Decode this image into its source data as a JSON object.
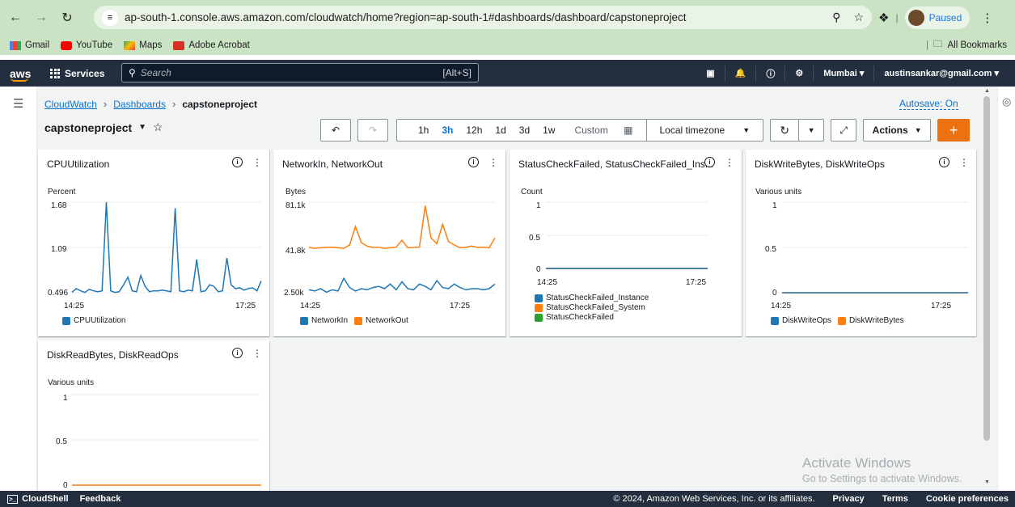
{
  "browser": {
    "url": "ap-south-1.console.aws.amazon.com/cloudwatch/home?region=ap-south-1#dashboards/dashboard/capstoneproject",
    "profile_status": "Paused"
  },
  "bookmarks": {
    "items": [
      "Gmail",
      "YouTube",
      "Maps",
      "Adobe Acrobat"
    ],
    "all_label": "All Bookmarks"
  },
  "aws_nav": {
    "logo": "aws",
    "services": "Services",
    "search_placeholder": "Search",
    "search_shortcut": "[Alt+S]",
    "region": "Mumbai ▾",
    "account": "austinsankar@gmail.com ▾"
  },
  "breadcrumb": {
    "items": [
      "CloudWatch",
      "Dashboards"
    ],
    "current": "capstoneproject"
  },
  "autosave": "Autosave: On",
  "dashboard": {
    "title": "capstoneproject",
    "time_ranges": [
      "1h",
      "3h",
      "12h",
      "1d",
      "3d",
      "1w",
      "Custom"
    ],
    "selected_range": "3h",
    "timezone": "Local timezone",
    "actions": "Actions"
  },
  "widgets": [
    {
      "title": "CPUUtilization",
      "unit": "Percent",
      "yticks": [
        "1.68",
        "1.09",
        "0.496"
      ],
      "xticks": [
        "14:25",
        "17:25"
      ],
      "legend": [
        "CPUUtilization"
      ]
    },
    {
      "title": "NetworkIn, NetworkOut",
      "unit": "Bytes",
      "yticks": [
        "81.1k",
        "41.8k",
        "2.50k"
      ],
      "xticks": [
        "14:25",
        "17:25"
      ],
      "legend": [
        "NetworkIn",
        "NetworkOut"
      ]
    },
    {
      "title": "StatusCheckFailed, StatusCheckFailed_Ins...",
      "unit": "Count",
      "yticks": [
        "1",
        "0.5",
        "0"
      ],
      "xticks": [
        "14:25",
        "17:25"
      ],
      "legend": [
        "StatusCheckFailed_Instance",
        "StatusCheckFailed_System",
        "StatusCheckFailed"
      ]
    },
    {
      "title": "DiskWriteBytes, DiskWriteOps",
      "unit": "Various units",
      "yticks": [
        "1",
        "0.5",
        "0"
      ],
      "xticks": [
        "14:25",
        "17:25"
      ],
      "legend": [
        "DiskWriteOps",
        "DiskWriteBytes"
      ]
    },
    {
      "title": "DiskReadBytes, DiskReadOps",
      "unit": "Various units",
      "yticks": [
        "1",
        "0.5",
        "0"
      ]
    }
  ],
  "colors": {
    "blue": "#1f77b4",
    "orange": "#ff7f0e",
    "green": "#2ca02c"
  },
  "chart_data": [
    {
      "type": "line",
      "title": "CPUUtilization",
      "ylabel": "Percent",
      "ylim": [
        0.496,
        1.68
      ],
      "x_range": [
        "14:25",
        "17:25"
      ],
      "series": [
        {
          "name": "CPUUtilization",
          "values": [
            0.5,
            0.55,
            0.52,
            0.5,
            0.54,
            0.52,
            0.51,
            0.52,
            1.68,
            0.52,
            0.5,
            0.51,
            0.6,
            0.7,
            0.52,
            0.51,
            0.72,
            0.58,
            0.51,
            0.52,
            0.52,
            0.53,
            0.52,
            0.51,
            1.6,
            0.52,
            0.51,
            0.53,
            0.52,
            0.93,
            0.51,
            0.52,
            0.6,
            0.58,
            0.51,
            0.52,
            0.95,
            0.6,
            0.55,
            0.56,
            0.53,
            0.55,
            0.56,
            0.52,
            0.65
          ]
        }
      ]
    },
    {
      "type": "line",
      "title": "NetworkIn, NetworkOut",
      "ylabel": "Bytes",
      "ylim": [
        2500,
        81100
      ],
      "x_range": [
        "14:25",
        "17:25"
      ],
      "series": [
        {
          "name": "NetworkIn",
          "values": [
            5000,
            4000,
            6000,
            3000,
            5000,
            4000,
            15000,
            7000,
            4000,
            6000,
            5000,
            7000,
            8000,
            6000,
            10000,
            5000,
            12000,
            6000,
            5000,
            10000,
            8000,
            5000,
            13000,
            7000,
            6000,
            10000,
            7000,
            5000,
            6000,
            6000,
            5000,
            6000,
            10000
          ]
        },
        {
          "name": "NetworkOut",
          "values": [
            41800,
            41000,
            41500,
            41800,
            42000,
            41500,
            41000,
            44000,
            60000,
            46000,
            43000,
            41800,
            42000,
            41000,
            41500,
            42000,
            48000,
            41500,
            41800,
            42000,
            78000,
            50000,
            45000,
            62000,
            47000,
            44000,
            41500,
            42000,
            43000,
            41800,
            42000,
            41500,
            50000
          ]
        }
      ]
    },
    {
      "type": "line",
      "title": "StatusCheckFailed, StatusCheckFailed_Ins...",
      "ylabel": "Count",
      "ylim": [
        0,
        1
      ],
      "x_range": [
        "14:25",
        "17:25"
      ],
      "series": [
        {
          "name": "StatusCheckFailed_Instance",
          "values": [
            0,
            0
          ]
        },
        {
          "name": "StatusCheckFailed_System",
          "values": [
            0,
            0
          ]
        },
        {
          "name": "StatusCheckFailed",
          "values": [
            0,
            0
          ]
        }
      ]
    },
    {
      "type": "line",
      "title": "DiskWriteBytes, DiskWriteOps",
      "ylabel": "Various units",
      "ylim": [
        0,
        1
      ],
      "x_range": [
        "14:25",
        "17:25"
      ],
      "series": [
        {
          "name": "DiskWriteOps",
          "values": [
            0,
            0
          ]
        },
        {
          "name": "DiskWriteBytes",
          "values": [
            0,
            0
          ]
        }
      ]
    },
    {
      "type": "line",
      "title": "DiskReadBytes, DiskReadOps",
      "ylabel": "Various units",
      "ylim": [
        0,
        1
      ],
      "series": [
        {
          "values": [
            0,
            0
          ]
        }
      ]
    }
  ],
  "watermark": {
    "line1": "Activate Windows",
    "line2": "Go to Settings to activate Windows."
  },
  "footer": {
    "cloudshell": "CloudShell",
    "feedback": "Feedback",
    "copyright": "© 2024, Amazon Web Services, Inc. or its affiliates.",
    "privacy": "Privacy",
    "terms": "Terms",
    "cookies": "Cookie preferences"
  }
}
